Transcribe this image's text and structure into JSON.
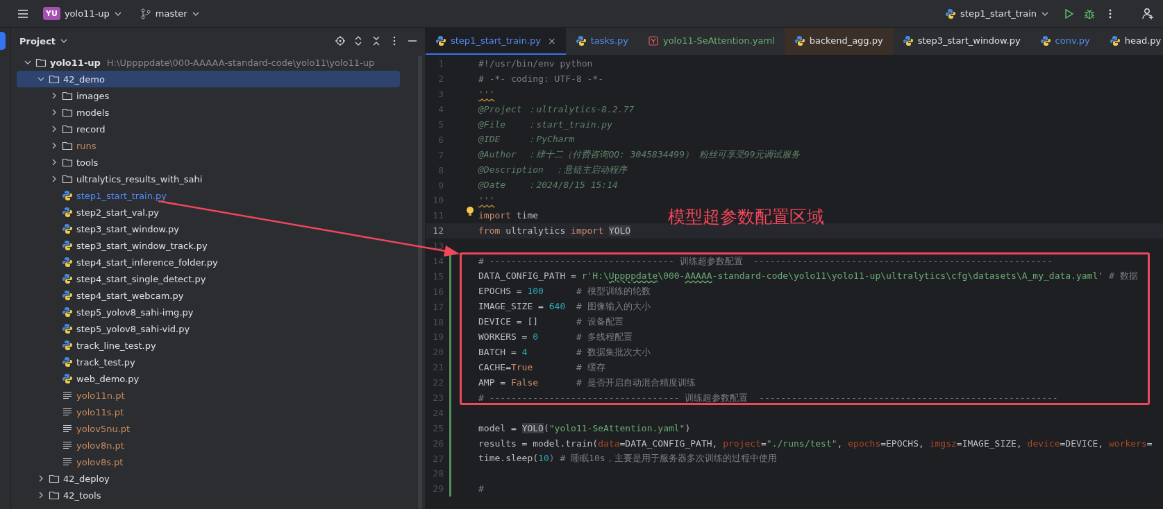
{
  "top_bar": {
    "project_badge": "YU",
    "project": "yolo11-up",
    "branch": "master",
    "run_config": "step1_start_train"
  },
  "project_panel": {
    "title": "Project",
    "tree": [
      {
        "label": "yolo11-up",
        "path": "H:\\Uppppdate\\000-AAAAA-standard-code\\yolo11\\yolo11-up",
        "kind": "folder",
        "expanded": true,
        "selected": false,
        "color": "#dfe1e5",
        "children": [
          {
            "label": "42_demo",
            "kind": "folder",
            "expanded": true,
            "selected": true,
            "color": "#dfe1e5",
            "children": [
              {
                "label": "images",
                "kind": "folder",
                "expanded": false,
                "selected": false,
                "color": "#dfe1e5"
              },
              {
                "label": "models",
                "kind": "folder",
                "expanded": false,
                "selected": false,
                "color": "#dfe1e5"
              },
              {
                "label": "record",
                "kind": "folder",
                "expanded": false,
                "selected": false,
                "color": "#dfe1e5"
              },
              {
                "label": "runs",
                "kind": "folder",
                "expanded": false,
                "selected": false,
                "color": "#c98a5e"
              },
              {
                "label": "tools",
                "kind": "folder",
                "expanded": false,
                "selected": false,
                "color": "#dfe1e5"
              },
              {
                "label": "ultralytics_results_with_sahi",
                "kind": "folder",
                "expanded": false,
                "selected": false,
                "color": "#dfe1e5"
              },
              {
                "label": "step1_start_train.py",
                "kind": "python",
                "selected": false,
                "color": "#548af7"
              },
              {
                "label": "step2_start_val.py",
                "kind": "python",
                "selected": false,
                "color": "#dfe1e5"
              },
              {
                "label": "step3_start_window.py",
                "kind": "python",
                "selected": false,
                "color": "#dfe1e5"
              },
              {
                "label": "step3_start_window_track.py",
                "kind": "python",
                "selected": false,
                "color": "#dfe1e5"
              },
              {
                "label": "step4_start_inference_folder.py",
                "kind": "python",
                "selected": false,
                "color": "#dfe1e5"
              },
              {
                "label": "step4_start_single_detect.py",
                "kind": "python",
                "selected": false,
                "color": "#dfe1e5"
              },
              {
                "label": "step4_start_webcam.py",
                "kind": "python",
                "selected": false,
                "color": "#dfe1e5"
              },
              {
                "label": "step5_yolov8_sahi-img.py",
                "kind": "python",
                "selected": false,
                "color": "#dfe1e5"
              },
              {
                "label": "step5_yolov8_sahi-vid.py",
                "kind": "python",
                "selected": false,
                "color": "#dfe1e5"
              },
              {
                "label": "track_line_test.py",
                "kind": "python",
                "selected": false,
                "color": "#dfe1e5"
              },
              {
                "label": "track_test.py",
                "kind": "python",
                "selected": false,
                "color": "#dfe1e5"
              },
              {
                "label": "web_demo.py",
                "kind": "python",
                "selected": false,
                "color": "#dfe1e5"
              },
              {
                "label": "yolo11n.pt",
                "kind": "binary",
                "selected": false,
                "color": "#c98a5e"
              },
              {
                "label": "yolo11s.pt",
                "kind": "binary",
                "selected": false,
                "color": "#c98a5e"
              },
              {
                "label": "yolov5nu.pt",
                "kind": "binary",
                "selected": false,
                "color": "#c98a5e"
              },
              {
                "label": "yolov8n.pt",
                "kind": "binary",
                "selected": false,
                "color": "#c98a5e"
              },
              {
                "label": "yolov8s.pt",
                "kind": "binary",
                "selected": false,
                "color": "#c98a5e"
              }
            ]
          },
          {
            "label": "42_deploy",
            "kind": "folder",
            "expanded": false,
            "selected": false,
            "color": "#dfe1e5"
          },
          {
            "label": "42_tools",
            "kind": "folder",
            "expanded": false,
            "selected": false,
            "color": "#dfe1e5"
          }
        ]
      }
    ]
  },
  "editor": {
    "tabs": [
      {
        "label": "step1_start_train.py",
        "kind": "python",
        "selected": true,
        "external": false,
        "color": "#548af7",
        "close": "×"
      },
      {
        "label": "tasks.py",
        "kind": "python",
        "selected": false,
        "external": false,
        "color": "#548af7"
      },
      {
        "label": "yolo11-SeAttention.yaml",
        "kind": "yaml",
        "selected": false,
        "external": false,
        "color": "#6aab73"
      },
      {
        "label": "backend_agg.py",
        "kind": "python",
        "selected": false,
        "external": true,
        "color": "#dfe1e5"
      },
      {
        "label": "step3_start_window.py",
        "kind": "python",
        "selected": false,
        "external": false,
        "color": "#dfe1e5"
      },
      {
        "label": "conv.py",
        "kind": "python",
        "selected": false,
        "external": false,
        "color": "#548af7"
      },
      {
        "label": "head.py",
        "kind": "python",
        "selected": false,
        "external": false,
        "color": "#dfe1e5"
      }
    ],
    "lines": [
      {
        "number": "1",
        "current": false,
        "changed": false,
        "bulb": false,
        "tokens": [
          {
            "kind": "comment",
            "text": "#!/usr/bin/env python"
          }
        ]
      },
      {
        "number": "2",
        "current": false,
        "changed": false,
        "bulb": false,
        "tokens": [
          {
            "kind": "comment",
            "text": "# -*- coding: UTF-8 -*-"
          }
        ]
      },
      {
        "number": "3",
        "current": false,
        "changed": false,
        "bulb": false,
        "tokens": [
          {
            "kind": "doc_warn",
            "text": "'''"
          }
        ]
      },
      {
        "number": "4",
        "current": false,
        "changed": false,
        "bulb": false,
        "tokens": [
          {
            "kind": "doc",
            "text": "@Project ：ultralytics-8.2.77"
          }
        ]
      },
      {
        "number": "5",
        "current": false,
        "changed": false,
        "bulb": false,
        "tokens": [
          {
            "kind": "doc",
            "text": "@File    ：start_train.py"
          }
        ]
      },
      {
        "number": "6",
        "current": false,
        "changed": false,
        "bulb": false,
        "tokens": [
          {
            "kind": "doc",
            "text": "@IDE     ：PyCharm"
          }
        ]
      },
      {
        "number": "7",
        "current": false,
        "changed": false,
        "bulb": false,
        "tokens": [
          {
            "kind": "doc",
            "text": "@Author  ：肆十二（付费咨询QQ: 3045834499） 粉丝可享受99元调试服务"
          }
        ]
      },
      {
        "number": "8",
        "current": false,
        "changed": false,
        "bulb": false,
        "tokens": [
          {
            "kind": "doc",
            "text": "@Description  ：悬链主启动程序"
          }
        ]
      },
      {
        "number": "9",
        "current": false,
        "changed": false,
        "bulb": false,
        "tokens": [
          {
            "kind": "doc",
            "text": "@Date    ：2024/8/15 15:14"
          }
        ]
      },
      {
        "number": "10",
        "current": false,
        "changed": false,
        "bulb": false,
        "tokens": [
          {
            "kind": "doc_warn",
            "text": "'''"
          }
        ]
      },
      {
        "number": "11",
        "current": false,
        "changed": false,
        "bulb": true,
        "tokens": [
          {
            "kind": "keyword",
            "text": "import"
          },
          {
            "kind": "plain",
            "text": " time"
          }
        ]
      },
      {
        "number": "12",
        "current": true,
        "changed": false,
        "bulb": false,
        "tokens": [
          {
            "kind": "keyword",
            "text": "from"
          },
          {
            "kind": "plain",
            "text": " ultralytics "
          },
          {
            "kind": "keyword",
            "text": "import "
          },
          {
            "kind": "ref",
            "text": "YOLO"
          }
        ]
      },
      {
        "number": "13",
        "current": false,
        "changed": false,
        "bulb": false
      },
      {
        "number": "14",
        "current": false,
        "changed": true,
        "bulb": false,
        "tokens": [
          {
            "kind": "comment",
            "text": "# ---------------------------------- 训练超参数配置  -------------------------------------------------------"
          }
        ]
      },
      {
        "number": "15",
        "current": false,
        "changed": true,
        "bulb": false,
        "tokens": [
          {
            "kind": "plain",
            "text": "DATA_CONFIG_PATH = "
          },
          {
            "kind": "string",
            "text": "r'H:\\"
          },
          {
            "kind": "string_typo",
            "text": "Uppppdate"
          },
          {
            "kind": "string",
            "text": "\\000-"
          },
          {
            "kind": "string_typo",
            "text": "AAAAA"
          },
          {
            "kind": "string",
            "text": "-standard-code\\yolo11\\yolo11-up\\ultralytics\\cfg\\datasets\\A_my_data.yaml'"
          },
          {
            "kind": "comment",
            "text": " # 数据"
          }
        ]
      },
      {
        "number": "16",
        "current": false,
        "changed": true,
        "bulb": false,
        "tokens": [
          {
            "kind": "plain",
            "text": "EPOCHS = "
          },
          {
            "kind": "number",
            "text": "100"
          },
          {
            "kind": "comment",
            "text": "      # 模型训练的轮数"
          }
        ]
      },
      {
        "number": "17",
        "current": false,
        "changed": true,
        "bulb": false,
        "tokens": [
          {
            "kind": "plain",
            "text": "IMAGE_SIZE = "
          },
          {
            "kind": "number",
            "text": "640"
          },
          {
            "kind": "comment",
            "text": "  # 图像输入的大小"
          }
        ]
      },
      {
        "number": "18",
        "current": false,
        "changed": true,
        "bulb": false,
        "tokens": [
          {
            "kind": "plain",
            "text": "DEVICE = []       "
          },
          {
            "kind": "comment",
            "text": "# 设备配置"
          }
        ]
      },
      {
        "number": "19",
        "current": false,
        "changed": true,
        "bulb": false,
        "tokens": [
          {
            "kind": "plain",
            "text": "WORKERS = "
          },
          {
            "kind": "number",
            "text": "0"
          },
          {
            "kind": "comment",
            "text": "       # 多线程配置"
          }
        ]
      },
      {
        "number": "20",
        "current": false,
        "changed": true,
        "bulb": false,
        "tokens": [
          {
            "kind": "plain",
            "text": "BATCH = "
          },
          {
            "kind": "number",
            "text": "4"
          },
          {
            "kind": "comment",
            "text": "         # 数据集批次大小"
          }
        ]
      },
      {
        "number": "21",
        "current": false,
        "changed": true,
        "bulb": false,
        "tokens": [
          {
            "kind": "plain",
            "text": "CACHE="
          },
          {
            "kind": "keyword",
            "text": "True"
          },
          {
            "kind": "comment",
            "text": "        # 缓存"
          }
        ]
      },
      {
        "number": "22",
        "current": false,
        "changed": true,
        "bulb": false,
        "tokens": [
          {
            "kind": "plain",
            "text": "AMP = "
          },
          {
            "kind": "keyword",
            "text": "False"
          },
          {
            "kind": "comment",
            "text": "       # 是否开启自动混合精度训练"
          }
        ]
      },
      {
        "number": "23",
        "current": false,
        "changed": true,
        "bulb": false,
        "tokens": [
          {
            "kind": "comment",
            "text": "# ----------------------------------- 训练超参数配置  -------------------------------------------------------"
          }
        ]
      },
      {
        "number": "24",
        "current": false,
        "changed": true,
        "bulb": false
      },
      {
        "number": "25",
        "current": false,
        "changed": true,
        "bulb": false,
        "tokens": [
          {
            "kind": "plain",
            "text": "model = "
          },
          {
            "kind": "ref",
            "text": "YOLO"
          },
          {
            "kind": "plain",
            "text": "("
          },
          {
            "kind": "string",
            "text": "\"yolo11-SeAttention.yaml\""
          },
          {
            "kind": "plain",
            "text": ")"
          }
        ]
      },
      {
        "number": "26",
        "current": false,
        "changed": true,
        "bulb": false,
        "tokens": [
          {
            "kind": "plain",
            "text": "results = model.train("
          },
          {
            "kind": "param",
            "text": "data"
          },
          {
            "kind": "plain",
            "text": "=DATA_CONFIG_PATH, "
          },
          {
            "kind": "param",
            "text": "project"
          },
          {
            "kind": "plain",
            "text": "="
          },
          {
            "kind": "string",
            "text": "\"./runs/test\""
          },
          {
            "kind": "plain",
            "text": ", "
          },
          {
            "kind": "param",
            "text": "epochs"
          },
          {
            "kind": "plain",
            "text": "=EPOCHS, "
          },
          {
            "kind": "param",
            "text": "imgsz"
          },
          {
            "kind": "plain",
            "text": "=IMAGE_SIZE, "
          },
          {
            "kind": "param",
            "text": "device"
          },
          {
            "kind": "plain",
            "text": "=DEVICE, "
          },
          {
            "kind": "param",
            "text": "workers"
          },
          {
            "kind": "plain",
            "text": "="
          }
        ]
      },
      {
        "number": "27",
        "current": false,
        "changed": true,
        "bulb": false,
        "tokens": [
          {
            "kind": "plain",
            "text": "time.sleep("
          },
          {
            "kind": "number",
            "text": "10"
          },
          {
            "kind": "comment",
            "text": ") # 睡眠10s，主要是用于服务器多次训练的过程中使用"
          }
        ]
      },
      {
        "number": "28",
        "current": false,
        "changed": true,
        "bulb": false
      },
      {
        "number": "29",
        "current": false,
        "changed": true,
        "bulb": false,
        "tokens": [
          {
            "kind": "comment",
            "text": "#"
          }
        ]
      }
    ]
  },
  "annotation": {
    "label": "模型超参数配置区域"
  }
}
